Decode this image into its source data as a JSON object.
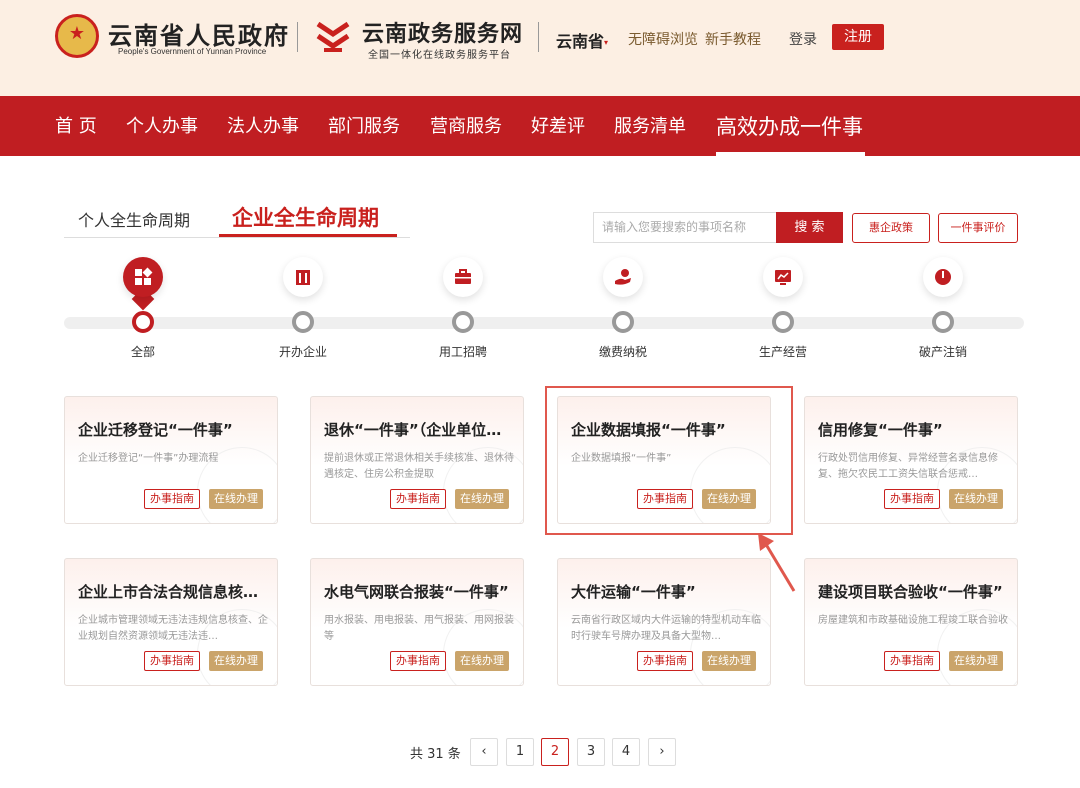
{
  "header": {
    "gov_title": "云南省人民政府",
    "gov_en": "People's Government of Yunnan Province",
    "service_title": "云南政务服务网",
    "service_subtitle": "全国一体化在线政务服务平台",
    "province": "云南省",
    "links": [
      "无障碍浏览",
      "新手教程"
    ],
    "login": "登录",
    "register": "注册",
    "brand_color": "#c01e22"
  },
  "nav": {
    "items": [
      "首 页",
      "个人办事",
      "法人办事",
      "部门服务",
      "营商服务",
      "好差评",
      "服务清单",
      "高效办成一件事"
    ],
    "active_index": 7
  },
  "lifecycle_tabs": {
    "personal": "个人全生命周期",
    "enterprise": "企业全生命周期",
    "active": "enterprise"
  },
  "search": {
    "placeholder": "请输入您要搜索的事项名称",
    "button": "搜 索",
    "policy_button": "惠企政策",
    "review_button": "一件事评价"
  },
  "steps": [
    {
      "label": "全部",
      "icon": "grid-icon",
      "active": true
    },
    {
      "label": "开办企业",
      "icon": "building-icon",
      "active": false
    },
    {
      "label": "用工招聘",
      "icon": "briefcase-icon",
      "active": false
    },
    {
      "label": "缴费纳税",
      "icon": "hand-coin-icon",
      "active": false
    },
    {
      "label": "生产经营",
      "icon": "chart-screen-icon",
      "active": false
    },
    {
      "label": "破产注销",
      "icon": "power-icon",
      "active": false
    }
  ],
  "cards": [
    {
      "title": "企业迁移登记“一件事”",
      "desc": "企业迁移登记“一件事”办理流程",
      "guide": "办事指南",
      "online": "在线办理"
    },
    {
      "title": "退休“一件事”（企业单位…",
      "desc": "提前退休或正常退休相关手续核准、退休待遇核定、住房公积金提取",
      "guide": "办事指南",
      "online": "在线办理"
    },
    {
      "title": "企业数据填报“一件事”",
      "desc": "企业数据填报“一件事”",
      "guide": "办事指南",
      "online": "在线办理"
    },
    {
      "title": "信用修复“一件事”",
      "desc": "行政处罚信用修复、异常经营名录信息修复、拖欠农民工工资失信联合惩戒…",
      "guide": "办事指南",
      "online": "在线办理"
    },
    {
      "title": "企业上市合法合规信息核查…",
      "desc": "企业城市管理领域无违法违规信息核查、企业规划自然资源领域无违法违…",
      "guide": "办事指南",
      "online": "在线办理"
    },
    {
      "title": "水电气网联合报装“一件事”",
      "desc": "用水报装、用电报装、用气报装、用网报装等",
      "guide": "办事指南",
      "online": "在线办理"
    },
    {
      "title": "大件运输“一件事”",
      "desc": "云南省行政区域内大件运输的特型机动车临时行驶车号牌办理及具备大型物…",
      "guide": "办事指南",
      "online": "在线办理"
    },
    {
      "title": "建设项目联合验收“一件事”",
      "desc": "房屋建筑和市政基础设施工程竣工联合验收",
      "guide": "办事指南",
      "online": "在线办理"
    }
  ],
  "pagination": {
    "total_text": "共 31 条",
    "prev": "‹",
    "pages": [
      "1",
      "2",
      "3",
      "4"
    ],
    "current": "2",
    "next": "›"
  }
}
